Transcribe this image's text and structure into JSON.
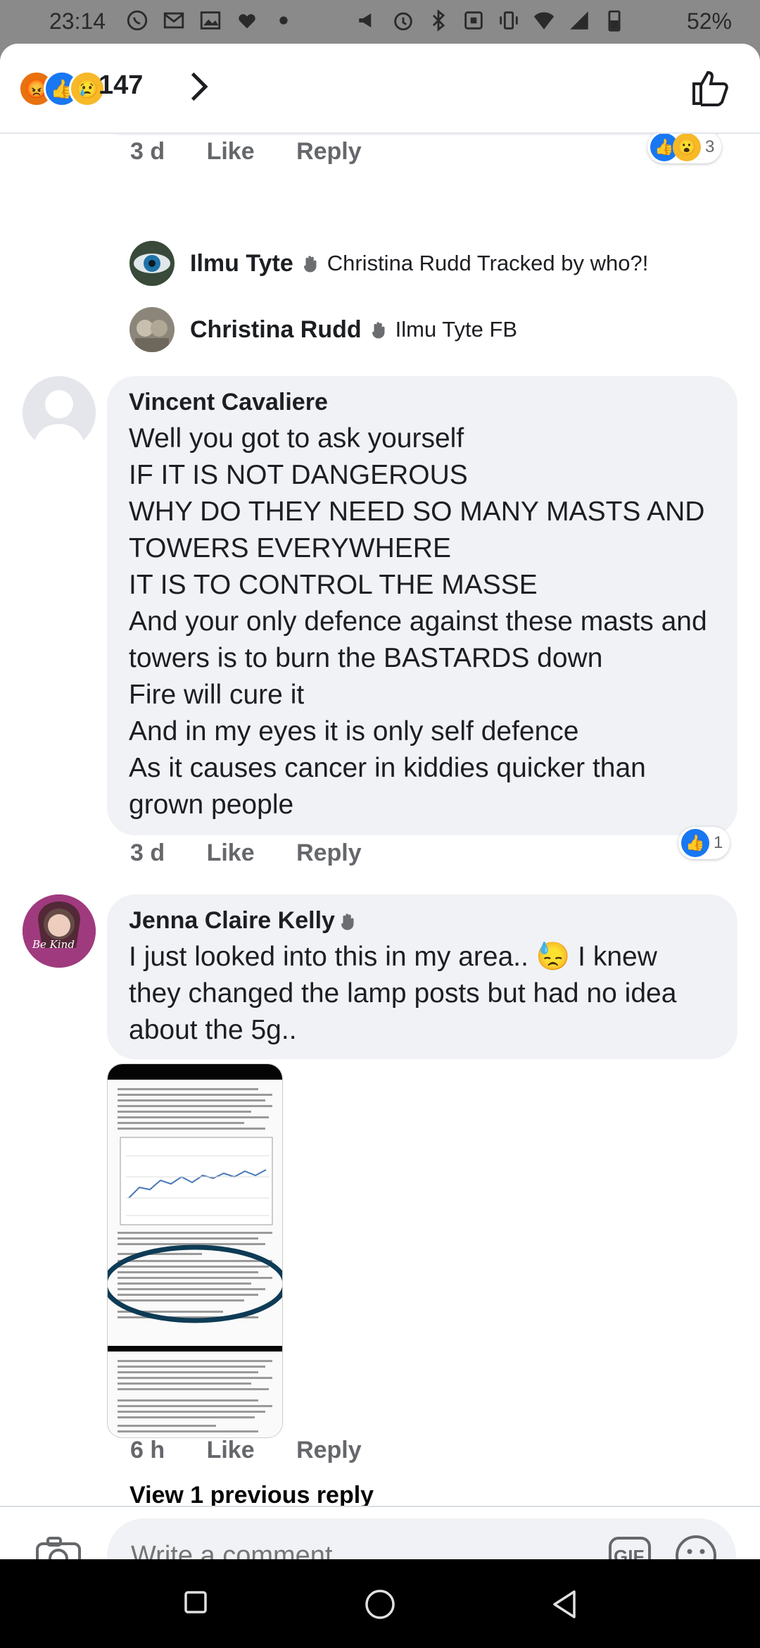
{
  "status_bar": {
    "time": "23:14",
    "battery": "52%",
    "left_icons": [
      "whatsapp-icon",
      "gmail-icon",
      "gallery-icon",
      "heart-icon",
      "dot-icon"
    ],
    "right_icons": [
      "megaphone-icon",
      "alarm-icon",
      "bluetooth-icon",
      "nfc-icon",
      "vibrate-icon",
      "wifi-icon",
      "signal-icon",
      "battery-icon"
    ]
  },
  "header": {
    "reaction_icons": [
      "angry-reaction",
      "like-reaction",
      "sad-reaction"
    ],
    "reaction_count": "147"
  },
  "comments": {
    "top": {
      "time": "3 d",
      "like": "Like",
      "reply": "Reply",
      "reaction_count": "3"
    },
    "reply1": {
      "name": "Ilmu Tyte",
      "text": "Christina Rudd Tracked by who?!"
    },
    "reply2": {
      "name": "Christina Rudd",
      "text": "Ilmu Tyte FB"
    },
    "vincent": {
      "name": "Vincent Cavaliere",
      "text": "Well you got to ask yourself\nIF IT IS NOT DANGEROUS\nWHY DO THEY NEED SO MANY MASTS AND TOWERS EVERYWHERE\nIT IS TO CONTROL THE MASSE\nAnd your only defence against these masts and towers is to burn the BASTARDS down\nFire will cure it\nAnd in my eyes it is only self defence\nAs it causes cancer in kiddies quicker than grown people",
      "time": "3 d",
      "like": "Like",
      "reply": "Reply",
      "reaction_count": "1"
    },
    "jenna": {
      "name": "Jenna Claire Kelly",
      "text": "I just looked into this in my area.. 😓 I knew they changed the lamp posts but had no idea about the 5g..",
      "avatar_text": "Be Kind",
      "time": "6 h",
      "like": "Like",
      "reply": "Reply"
    },
    "view_previous": "View 1 previous reply"
  },
  "composer": {
    "placeholder": "Write a comment…",
    "gif_label": "GIF"
  }
}
